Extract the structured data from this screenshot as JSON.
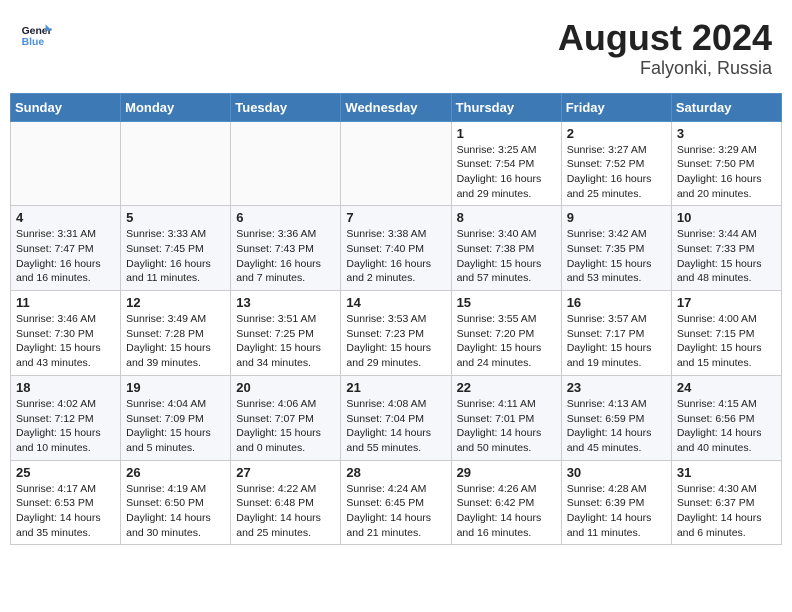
{
  "header": {
    "logo_line1": "General",
    "logo_line2": "Blue",
    "month_year": "August 2024",
    "location": "Falyonki, Russia"
  },
  "weekdays": [
    "Sunday",
    "Monday",
    "Tuesday",
    "Wednesday",
    "Thursday",
    "Friday",
    "Saturday"
  ],
  "weeks": [
    [
      {
        "day": "",
        "detail": ""
      },
      {
        "day": "",
        "detail": ""
      },
      {
        "day": "",
        "detail": ""
      },
      {
        "day": "",
        "detail": ""
      },
      {
        "day": "1",
        "detail": "Sunrise: 3:25 AM\nSunset: 7:54 PM\nDaylight: 16 hours\nand 29 minutes."
      },
      {
        "day": "2",
        "detail": "Sunrise: 3:27 AM\nSunset: 7:52 PM\nDaylight: 16 hours\nand 25 minutes."
      },
      {
        "day": "3",
        "detail": "Sunrise: 3:29 AM\nSunset: 7:50 PM\nDaylight: 16 hours\nand 20 minutes."
      }
    ],
    [
      {
        "day": "4",
        "detail": "Sunrise: 3:31 AM\nSunset: 7:47 PM\nDaylight: 16 hours\nand 16 minutes."
      },
      {
        "day": "5",
        "detail": "Sunrise: 3:33 AM\nSunset: 7:45 PM\nDaylight: 16 hours\nand 11 minutes."
      },
      {
        "day": "6",
        "detail": "Sunrise: 3:36 AM\nSunset: 7:43 PM\nDaylight: 16 hours\nand 7 minutes."
      },
      {
        "day": "7",
        "detail": "Sunrise: 3:38 AM\nSunset: 7:40 PM\nDaylight: 16 hours\nand 2 minutes."
      },
      {
        "day": "8",
        "detail": "Sunrise: 3:40 AM\nSunset: 7:38 PM\nDaylight: 15 hours\nand 57 minutes."
      },
      {
        "day": "9",
        "detail": "Sunrise: 3:42 AM\nSunset: 7:35 PM\nDaylight: 15 hours\nand 53 minutes."
      },
      {
        "day": "10",
        "detail": "Sunrise: 3:44 AM\nSunset: 7:33 PM\nDaylight: 15 hours\nand 48 minutes."
      }
    ],
    [
      {
        "day": "11",
        "detail": "Sunrise: 3:46 AM\nSunset: 7:30 PM\nDaylight: 15 hours\nand 43 minutes."
      },
      {
        "day": "12",
        "detail": "Sunrise: 3:49 AM\nSunset: 7:28 PM\nDaylight: 15 hours\nand 39 minutes."
      },
      {
        "day": "13",
        "detail": "Sunrise: 3:51 AM\nSunset: 7:25 PM\nDaylight: 15 hours\nand 34 minutes."
      },
      {
        "day": "14",
        "detail": "Sunrise: 3:53 AM\nSunset: 7:23 PM\nDaylight: 15 hours\nand 29 minutes."
      },
      {
        "day": "15",
        "detail": "Sunrise: 3:55 AM\nSunset: 7:20 PM\nDaylight: 15 hours\nand 24 minutes."
      },
      {
        "day": "16",
        "detail": "Sunrise: 3:57 AM\nSunset: 7:17 PM\nDaylight: 15 hours\nand 19 minutes."
      },
      {
        "day": "17",
        "detail": "Sunrise: 4:00 AM\nSunset: 7:15 PM\nDaylight: 15 hours\nand 15 minutes."
      }
    ],
    [
      {
        "day": "18",
        "detail": "Sunrise: 4:02 AM\nSunset: 7:12 PM\nDaylight: 15 hours\nand 10 minutes."
      },
      {
        "day": "19",
        "detail": "Sunrise: 4:04 AM\nSunset: 7:09 PM\nDaylight: 15 hours\nand 5 minutes."
      },
      {
        "day": "20",
        "detail": "Sunrise: 4:06 AM\nSunset: 7:07 PM\nDaylight: 15 hours\nand 0 minutes."
      },
      {
        "day": "21",
        "detail": "Sunrise: 4:08 AM\nSunset: 7:04 PM\nDaylight: 14 hours\nand 55 minutes."
      },
      {
        "day": "22",
        "detail": "Sunrise: 4:11 AM\nSunset: 7:01 PM\nDaylight: 14 hours\nand 50 minutes."
      },
      {
        "day": "23",
        "detail": "Sunrise: 4:13 AM\nSunset: 6:59 PM\nDaylight: 14 hours\nand 45 minutes."
      },
      {
        "day": "24",
        "detail": "Sunrise: 4:15 AM\nSunset: 6:56 PM\nDaylight: 14 hours\nand 40 minutes."
      }
    ],
    [
      {
        "day": "25",
        "detail": "Sunrise: 4:17 AM\nSunset: 6:53 PM\nDaylight: 14 hours\nand 35 minutes."
      },
      {
        "day": "26",
        "detail": "Sunrise: 4:19 AM\nSunset: 6:50 PM\nDaylight: 14 hours\nand 30 minutes."
      },
      {
        "day": "27",
        "detail": "Sunrise: 4:22 AM\nSunset: 6:48 PM\nDaylight: 14 hours\nand 25 minutes."
      },
      {
        "day": "28",
        "detail": "Sunrise: 4:24 AM\nSunset: 6:45 PM\nDaylight: 14 hours\nand 21 minutes."
      },
      {
        "day": "29",
        "detail": "Sunrise: 4:26 AM\nSunset: 6:42 PM\nDaylight: 14 hours\nand 16 minutes."
      },
      {
        "day": "30",
        "detail": "Sunrise: 4:28 AM\nSunset: 6:39 PM\nDaylight: 14 hours\nand 11 minutes."
      },
      {
        "day": "31",
        "detail": "Sunrise: 4:30 AM\nSunset: 6:37 PM\nDaylight: 14 hours\nand 6 minutes."
      }
    ]
  ]
}
